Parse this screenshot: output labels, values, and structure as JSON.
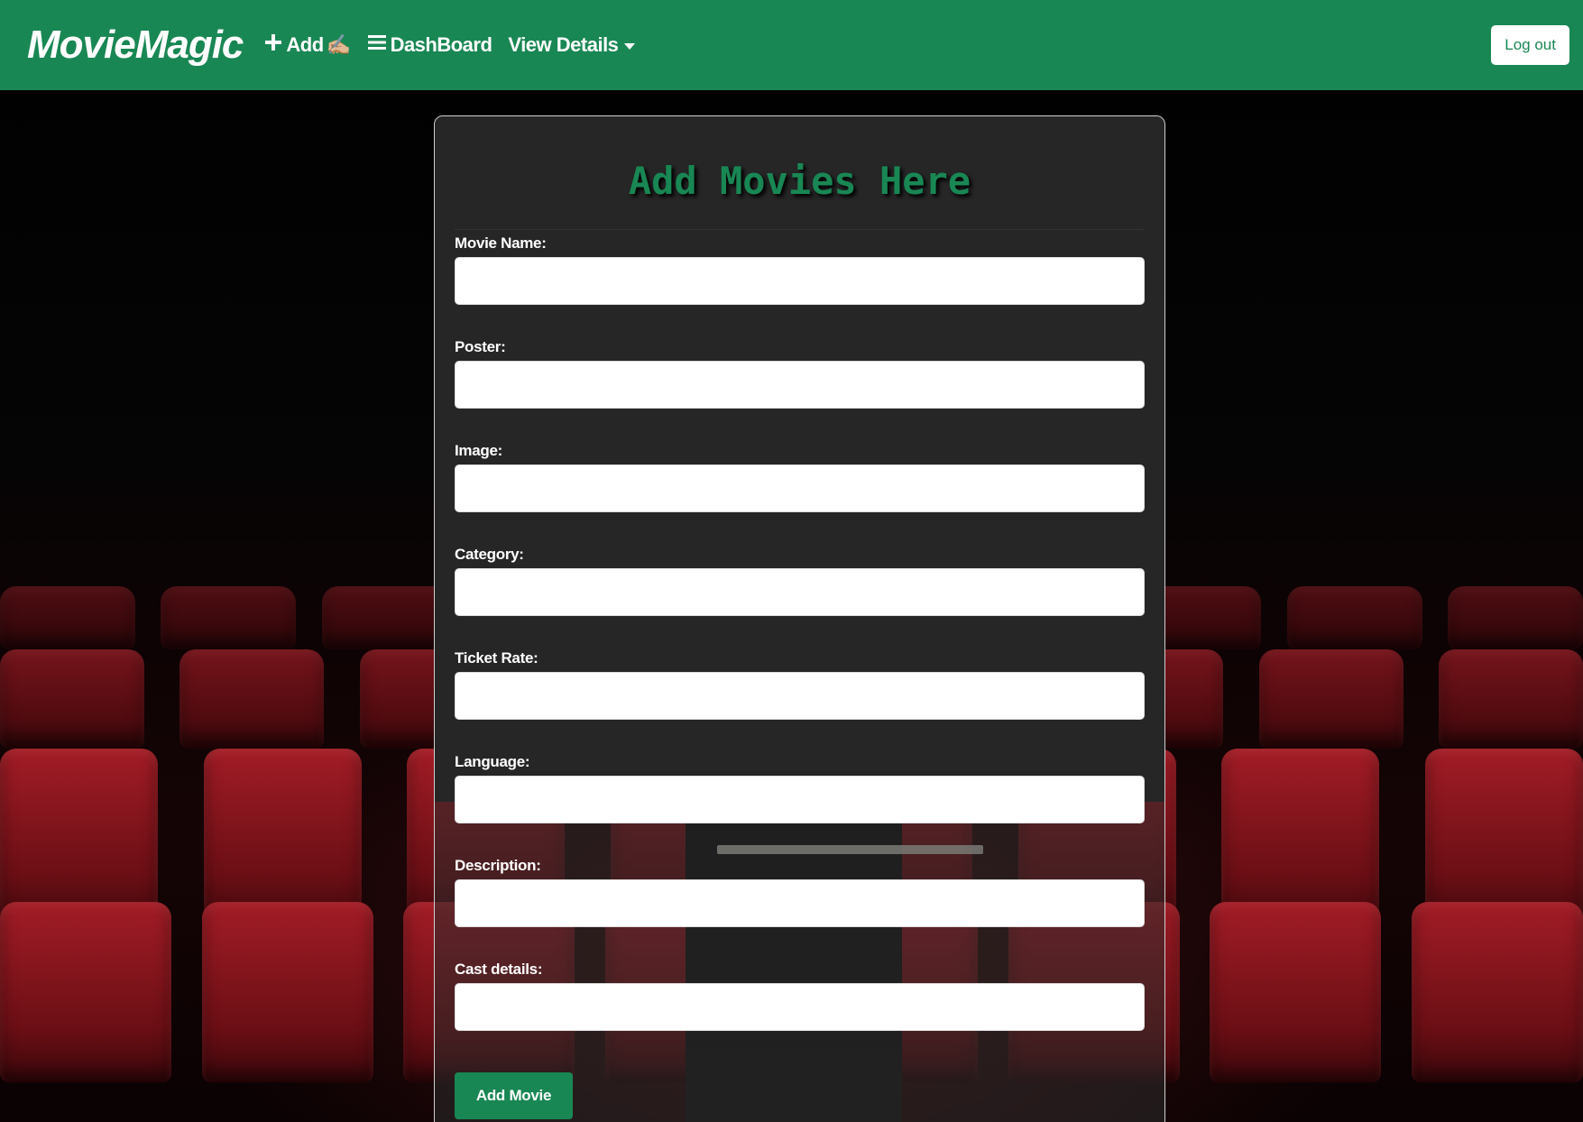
{
  "navbar": {
    "brand": "MovieMagic",
    "links": [
      {
        "label": "Add",
        "icon": "plus-icon"
      },
      {
        "label": "DashBoard",
        "icon": "menu-icon"
      },
      {
        "label": "View Details",
        "icon": "chevron-down-icon"
      }
    ],
    "add_emoji": "✍🏼",
    "logout_label": "Log out",
    "background_color": "#198754"
  },
  "form": {
    "title": "Add Movies Here",
    "fields": [
      {
        "label": "Movie Name:",
        "value": ""
      },
      {
        "label": "Poster:",
        "value": ""
      },
      {
        "label": "Image:",
        "value": ""
      },
      {
        "label": "Category:",
        "value": ""
      },
      {
        "label": "Ticket Rate:",
        "value": ""
      },
      {
        "label": "Language:",
        "value": ""
      },
      {
        "label": "Description:",
        "value": ""
      },
      {
        "label": "Cast details:",
        "value": ""
      }
    ],
    "submit_label": "Add Movie",
    "accent_color": "#198754"
  }
}
